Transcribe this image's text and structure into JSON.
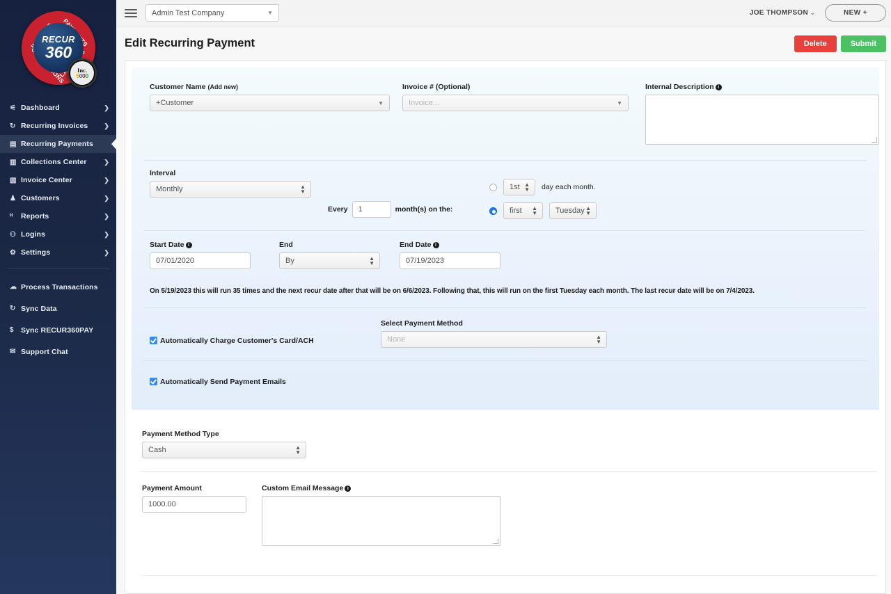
{
  "brand": {
    "logo_line1": "RECUR",
    "logo_line2": "360",
    "ring_top_left": "INVOICES",
    "ring_top_right": "PAYMENTS",
    "ring_bottom_left": "COLLECTIONS",
    "ring_bottom_right": "LATE FEES",
    "badge_line1": "Inc.",
    "badge_line2": "5000",
    "accent_red": "#c9222e",
    "accent_blue": "#14325c"
  },
  "sidebar": {
    "items": [
      {
        "label": "Dashboard",
        "icon": "dashboard-icon",
        "glyph": "⚟",
        "chevron": "❯",
        "active": false
      },
      {
        "label": "Recurring Invoices",
        "icon": "refresh-icon",
        "glyph": "↻",
        "chevron": "❯",
        "active": false
      },
      {
        "label": "Recurring Payments",
        "icon": "credit-card-icon",
        "glyph": "▤",
        "chevron": "",
        "active": true
      },
      {
        "label": "Collections Center",
        "icon": "document-collect-icon",
        "glyph": "▥",
        "chevron": "❯",
        "active": false
      },
      {
        "label": "Invoice Center",
        "icon": "file-icon",
        "glyph": "▧",
        "chevron": "❯",
        "active": false
      },
      {
        "label": "Customers",
        "icon": "people-icon",
        "glyph": "♟",
        "chevron": "❯",
        "active": false
      },
      {
        "label": "Reports",
        "icon": "bar-chart-icon",
        "glyph": "ᴴ",
        "chevron": "❯",
        "active": false
      },
      {
        "label": "Logins",
        "icon": "user-add-icon",
        "glyph": "⚇",
        "chevron": "❯",
        "active": false
      },
      {
        "label": "Settings",
        "icon": "gears-icon",
        "glyph": "⚙",
        "chevron": "❯",
        "active": false
      }
    ],
    "bottom_items": [
      {
        "label": "Process Transactions",
        "icon": "cloud-icon",
        "glyph": "☁"
      },
      {
        "label": "Sync Data",
        "icon": "sync-icon",
        "glyph": "↻"
      },
      {
        "label": "Sync RECUR360PAY",
        "icon": "dollar-icon",
        "glyph": "$"
      },
      {
        "label": "Support Chat",
        "icon": "chat-icon",
        "glyph": "✉"
      }
    ]
  },
  "topbar": {
    "menu_icon": "hamburger-icon",
    "company": "Admin Test Company",
    "company_caret": "▼",
    "user": "JOE THOMPSON",
    "user_caret": "⌄",
    "new_button": "NEW +"
  },
  "page": {
    "title": "Edit Recurring Payment",
    "delete_label": "Delete",
    "submit_label": "Submit",
    "delete_color": "#e8403a",
    "submit_color": "#4cc164"
  },
  "form": {
    "customer": {
      "label": "Customer Name",
      "label_sub": "(Add new)",
      "value": "+Customer"
    },
    "invoice": {
      "label": "Invoice # (Optional)",
      "placeholder": "Invoice..."
    },
    "internal_description": {
      "label": "Internal Description",
      "value": ""
    },
    "interval": {
      "label": "Interval",
      "value": "Monthly",
      "every_label": "Every",
      "every_value": "1",
      "months_on_label": "month(s) on the:",
      "day_of_month": {
        "selected": false,
        "value": "1st",
        "suffix": "day each month."
      },
      "day_of_week": {
        "selected": true,
        "ordinal": "first",
        "weekday": "Tuesday"
      }
    },
    "start_date": {
      "label": "Start Date",
      "value": "07/01/2020"
    },
    "end": {
      "label": "End",
      "value": "By"
    },
    "end_date": {
      "label": "End Date",
      "value": "07/19/2023"
    },
    "schedule_note": "On 5/19/2023 this will run 35 times and the next recur date after that will be on 6/6/2023. Following that, this will run on the first Tuesday each month. The last recur date will be on 7/4/2023.",
    "auto_charge": {
      "label": "Automatically Charge Customer's Card/ACH",
      "checked": true
    },
    "payment_method": {
      "label": "Select Payment Method",
      "value": "None"
    },
    "auto_email": {
      "label": "Automatically Send Payment Emails",
      "checked": true
    },
    "payment_method_type": {
      "label": "Payment Method Type",
      "value": "Cash"
    },
    "payment_amount": {
      "label": "Payment Amount",
      "value": "1000.00"
    },
    "custom_email_message": {
      "label": "Custom Email Message",
      "value": ""
    }
  }
}
